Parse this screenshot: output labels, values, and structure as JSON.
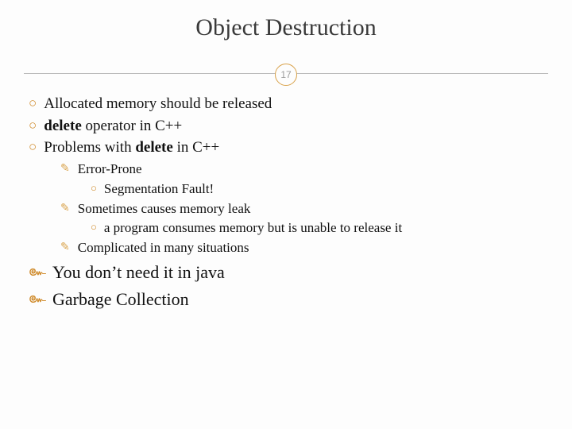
{
  "title": "Object Destruction",
  "page_number": "17",
  "bullets": {
    "b1": "Allocated memory should be released",
    "b2_pre": "delete",
    "b2_post": " operator in C++",
    "b3_pre": "Problems with ",
    "b3_bold": "delete",
    "b3_post": " in C++",
    "s1": "Error-Prone",
    "s1a": "Segmentation Fault!",
    "s2": "Sometimes causes memory leak",
    "s2a": "a program consumes memory but is unable to release it",
    "s3": "Complicated in many situations",
    "c1": "You don’t need it in java",
    "c2": "Garbage Collection"
  }
}
